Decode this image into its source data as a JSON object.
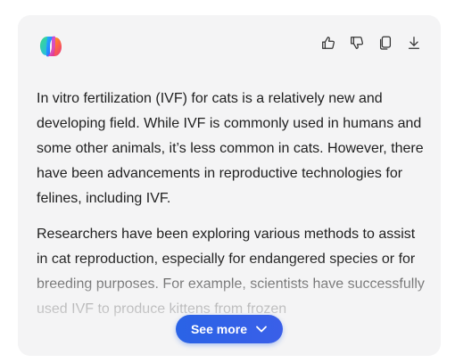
{
  "actions": {
    "like_icon": "thumbs-up-icon",
    "dislike_icon": "thumbs-down-icon",
    "copy_icon": "copy-icon",
    "download_icon": "download-icon"
  },
  "message": {
    "paragraphs": [
      "In vitro fertilization (IVF) for cats is a relatively new and developing field. While IVF is commonly used in humans and some other animals, it’s less common in cats. However, there have been advancements in reproductive technologies for felines, including IVF.",
      "Researchers have been exploring various methods to assist in cat reproduction, especially for endangered species or for breeding purposes. For example, scientists have successfully used IVF to produce kittens from frozen"
    ]
  },
  "see_more": {
    "label": "See more"
  },
  "colors": {
    "card_bg": "#f4f4f5",
    "text": "#1f1f1f",
    "accent": "#2a63e6"
  }
}
